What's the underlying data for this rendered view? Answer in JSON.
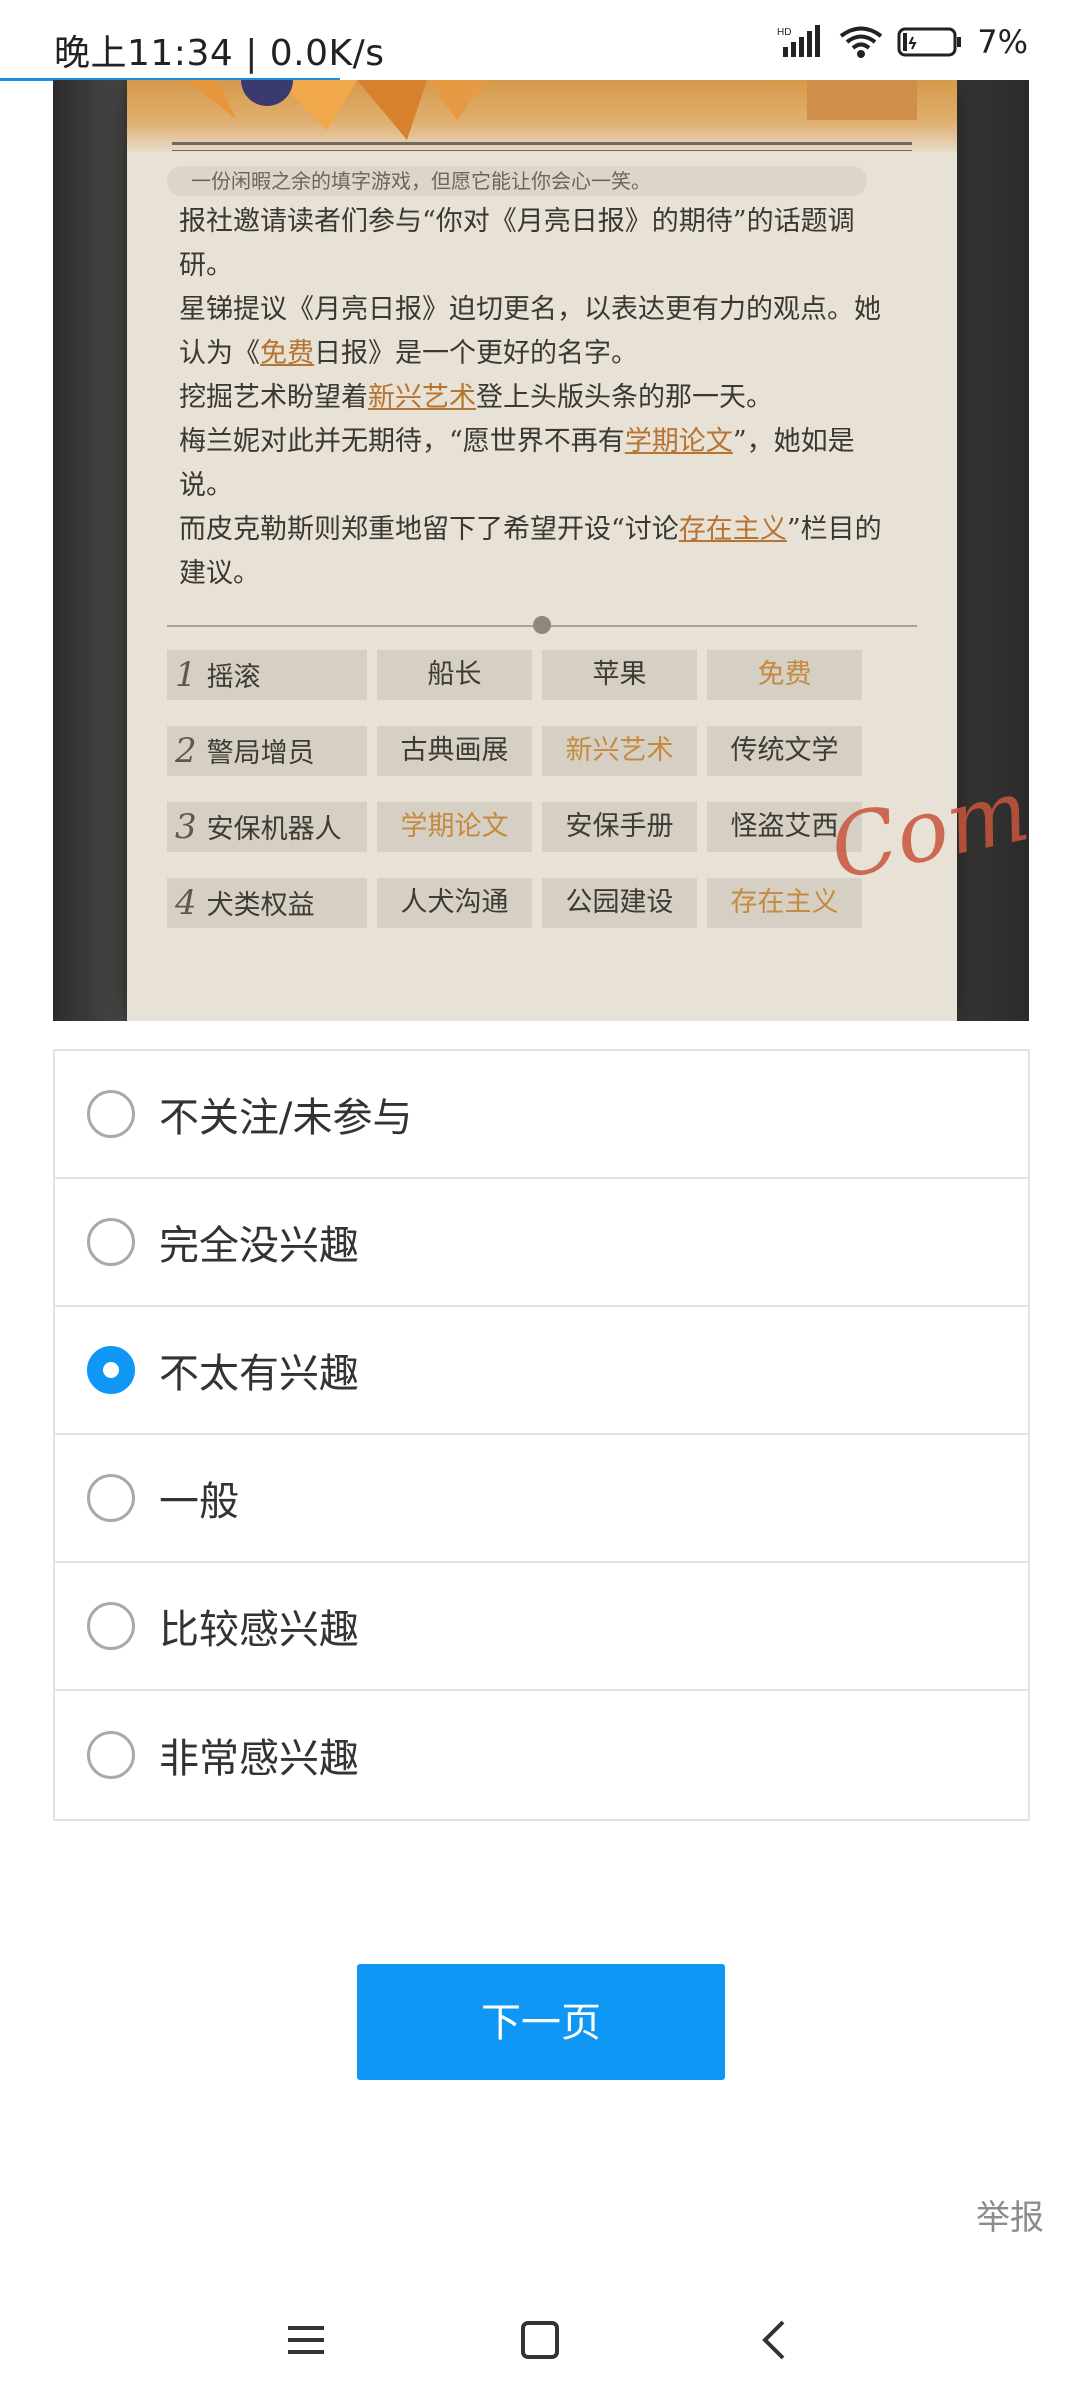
{
  "status_bar": {
    "time_speed": "晚上11:34 | 0.0K/s",
    "signal_label": "HD",
    "battery": "7%"
  },
  "image": {
    "slogan": "一份闲暇之余的填字游戏，但愿它能让你会心一笑。",
    "article": [
      [
        "报社邀请读者们参与“你对《月亮日报》的期待”的话题调研。"
      ],
      [
        "星锑提议《月亮日报》迫切更名，以表达更有力的观点。她认为《",
        {
          "hl": "免费"
        },
        "日报》是一个更好的名字。"
      ],
      [
        "挖掘艺术盼望着",
        {
          "hl": "新兴艺术"
        },
        "登上头版头条的那一天。"
      ],
      [
        "梅兰妮对此并无期待，“愿世界不再有",
        {
          "hl": "学期论文"
        },
        "”，她如是说。"
      ],
      [
        "而皮克勒斯则郑重地留下了希望开设“讨论",
        {
          "hl": "存在主义"
        },
        "”栏目的建议。"
      ]
    ],
    "grid": [
      {
        "num": "1",
        "cells": [
          {
            "t": "摇滚"
          },
          {
            "t": "船长"
          },
          {
            "t": "苹果"
          },
          {
            "t": "免费",
            "gold": true
          }
        ]
      },
      {
        "num": "2",
        "cells": [
          {
            "t": "警局增员"
          },
          {
            "t": "古典画展"
          },
          {
            "t": "新兴艺术",
            "gold": true
          },
          {
            "t": "传统文学"
          }
        ]
      },
      {
        "num": "3",
        "cells": [
          {
            "t": "安保机器人"
          },
          {
            "t": "学期论文",
            "gold": true
          },
          {
            "t": "安保手册"
          },
          {
            "t": "怪盗艾西"
          }
        ]
      },
      {
        "num": "4",
        "cells": [
          {
            "t": "犬类权益"
          },
          {
            "t": "人犬沟通"
          },
          {
            "t": "公园建设"
          },
          {
            "t": "存在主义",
            "gold": true
          }
        ]
      }
    ],
    "signature": "Com"
  },
  "options": [
    {
      "label": "不关注/未参与",
      "checked": false
    },
    {
      "label": "完全没兴趣",
      "checked": false
    },
    {
      "label": "不太有兴趣",
      "checked": true
    },
    {
      "label": "一般",
      "checked": false
    },
    {
      "label": "比较感兴趣",
      "checked": false
    },
    {
      "label": "非常感兴趣",
      "checked": false
    }
  ],
  "next_button": "下一页",
  "report_link": "举报",
  "colors": {
    "accent": "#0e97f5",
    "highlight": "#c48a3f"
  },
  "nav_icons": [
    "menu-icon",
    "home-icon",
    "back-icon"
  ]
}
